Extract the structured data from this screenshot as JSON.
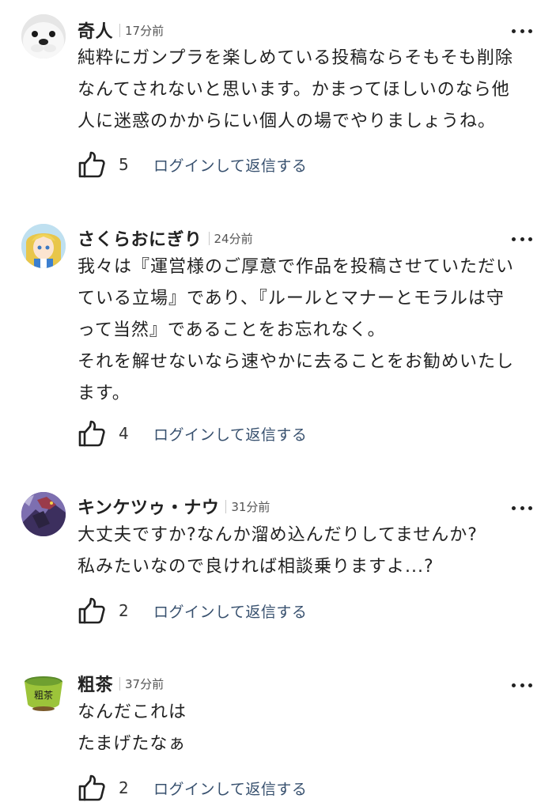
{
  "comments": [
    {
      "username": "奇人",
      "time": "17分前",
      "lines": [
        "純粋にガンプラを楽しめている投稿ならそもそも削除",
        "なんてされないと思います。かまってほしいのなら他",
        "人に迷惑のかからにい個人の場でやりましょうね。"
      ],
      "likes": "5",
      "reply_label": "ログインして返信する",
      "avatar": "seal-face-avatar"
    },
    {
      "username": "さくらおにぎり",
      "time": "24分前",
      "lines": [
        "我々は『運営様のご厚意で作品を投稿させていただい",
        "ている立場』であり、『ルールとマナーとモラルは守",
        "って当然』であることをお忘れなく。",
        "それを解せないなら速やかに去ることをお勧めいたし",
        "ます。"
      ],
      "likes": "4",
      "reply_label": "ログインして返信する",
      "avatar": "anime-girl-avatar"
    },
    {
      "username": "キンケツゥ・ナウ",
      "time": "31分前",
      "lines": [
        "大丈夫ですか?なんか溜め込んだりしてませんか?",
        "私みたいなので良ければ相談乗りますよ...?"
      ],
      "likes": "2",
      "reply_label": "ログインして返信する",
      "avatar": "dragon-avatar"
    },
    {
      "username": "粗茶",
      "time": "37分前",
      "lines": [
        "なんだこれは",
        "たまげたなぁ"
      ],
      "likes": "2",
      "reply_label": "ログインして返信する",
      "avatar": "tea-cup-avatar",
      "avatar_text": "粗茶"
    }
  ],
  "colors": {
    "reply_link": "#37506e",
    "text": "#222222",
    "separator": "#c8c8c8"
  },
  "icons": {
    "like": "thumbs-up-icon",
    "more": "more-dots-icon"
  }
}
